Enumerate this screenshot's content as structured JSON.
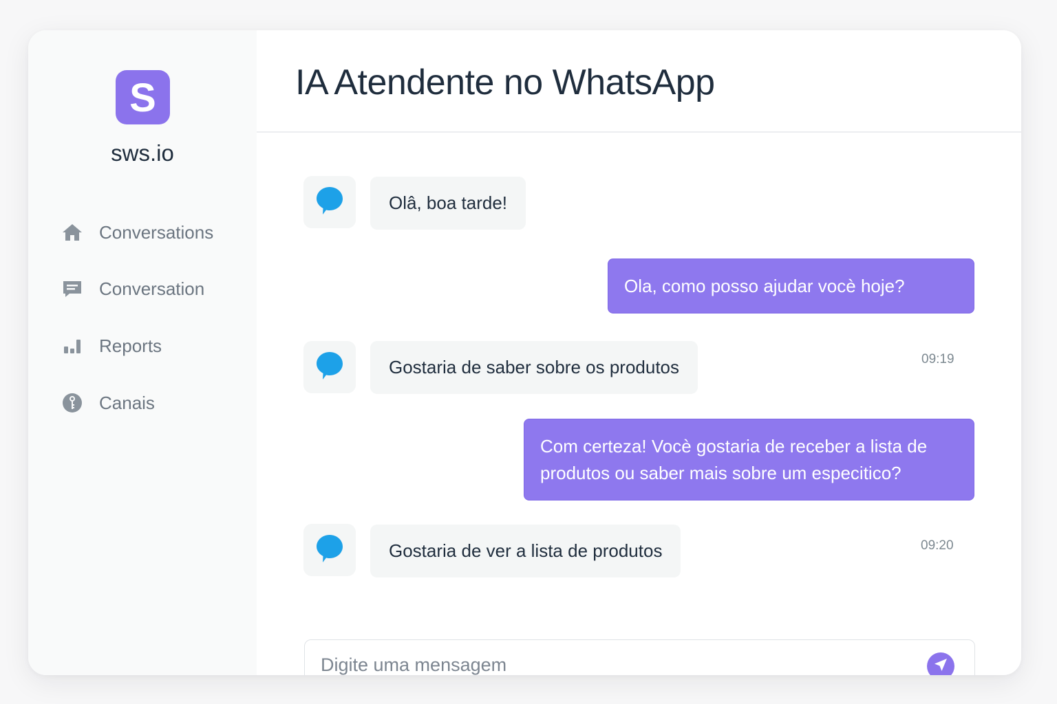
{
  "brand": {
    "initial": "S",
    "name": "sws.io",
    "accent": "#8b73ec"
  },
  "sidebar": {
    "items": [
      {
        "label": "Conversations",
        "icon": "home-icon"
      },
      {
        "label": "Conversation",
        "icon": "message-square-icon"
      },
      {
        "label": "Reports",
        "icon": "bar-chart-icon"
      },
      {
        "label": "Canais",
        "icon": "info-circle-icon"
      }
    ]
  },
  "header": {
    "title": "IA Atendente no WhatsApp"
  },
  "messages": [
    {
      "direction": "incoming",
      "text": "Olâ, boa tarde!",
      "avatar_icon": "chat-bubble-icon"
    },
    {
      "direction": "outgoing",
      "text": "Ola, como posso ajudar vocè hoje?",
      "time": "09:19"
    },
    {
      "direction": "incoming",
      "text": "Gostaria de saber sobre os produtos",
      "avatar_icon": "chat-bubble-icon"
    },
    {
      "direction": "outgoing",
      "lines": [
        "Com certeza! Vocè gostaria de receber a lista de",
        "produtos ou saber mais sobre um especitico?"
      ],
      "time": "09:20"
    },
    {
      "direction": "incoming",
      "text": "Gostaria de ver a lista de produtos",
      "avatar_icon": "chat-bubble-icon"
    }
  ],
  "composer": {
    "placeholder": "Digite uma mensagem",
    "value": "",
    "send_icon": "send-icon"
  },
  "colors": {
    "outgoing_bubble": "#8e78ee",
    "incoming_bubble": "#f4f6f6",
    "avatar_icon": "#1da1e8"
  }
}
